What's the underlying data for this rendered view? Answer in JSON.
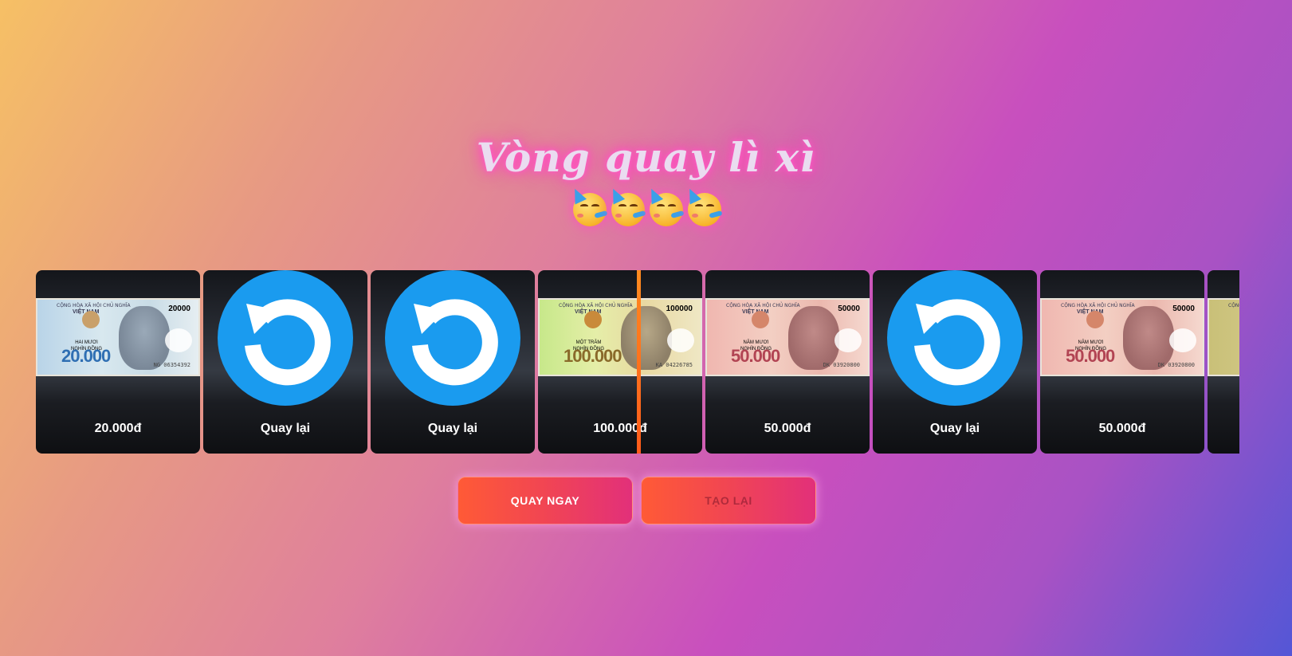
{
  "header": {
    "title": "Vòng quay lì xì",
    "emoji_count": 4,
    "emoji_icon": "partying-face-icon"
  },
  "spinner": {
    "cards": [
      {
        "kind": "bill",
        "variant": "b20",
        "label": "20.000đ",
        "denom": "20.000",
        "corner": "20000",
        "words": "HAI MƯƠI\nNGHÌN ĐỒNG",
        "serial": "NG 06354392"
      },
      {
        "kind": "retry",
        "label": "Quay lại"
      },
      {
        "kind": "retry",
        "label": "Quay lại"
      },
      {
        "kind": "bill",
        "variant": "b100",
        "label": "100.000đ",
        "denom": "100.000",
        "corner": "100000",
        "words": "MỘT TRĂM\nNGHÌN ĐỒNG",
        "serial": "KA 04226785"
      },
      {
        "kind": "bill",
        "variant": "b50",
        "label": "50.000đ",
        "denom": "50.000",
        "corner": "50000",
        "words": "NĂM MƯƠI\nNGHÌN ĐỒNG",
        "serial": "DK 03920800"
      },
      {
        "kind": "retry",
        "label": "Quay lại"
      },
      {
        "kind": "bill",
        "variant": "b50",
        "label": "50.000đ",
        "denom": "50.000",
        "corner": "50000",
        "words": "NĂM MƯƠI\nNGHÌN ĐỒNG",
        "serial": "DK 03920800"
      },
      {
        "kind": "bill",
        "variant": "b200",
        "label": "",
        "denom": "",
        "corner": "",
        "words": "",
        "serial": ""
      }
    ],
    "bill_header": "CỘNG HÒA XÃ HỘI CHỦ NGHĨA",
    "bill_country": "VIỆT NAM",
    "pointer_color": "#ff7a1a"
  },
  "buttons": {
    "spin_label": "QUAY NGAY",
    "reset_label": "TẠO LẠI"
  },
  "colors": {
    "retry_blue": "#1a9bef",
    "button_gradient_start": "#ff5a36",
    "button_gradient_end": "#e2307a"
  }
}
